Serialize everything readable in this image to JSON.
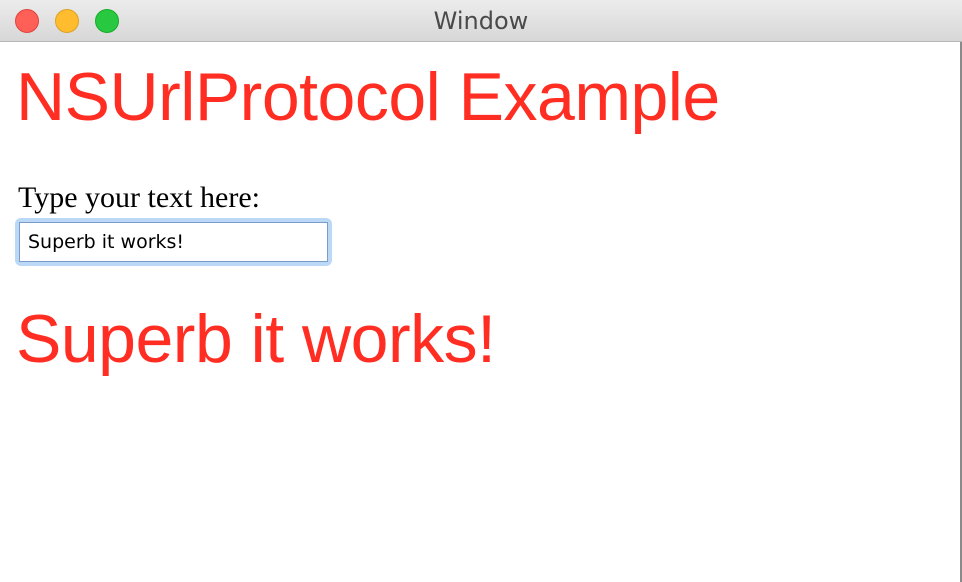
{
  "window": {
    "title": "Window"
  },
  "colors": {
    "accent": "#ff2d22",
    "focus_ring": "#bcd8f7"
  },
  "page": {
    "heading": "NSUrlProtocol Example",
    "prompt_label": "Type your text here:",
    "input": {
      "value": "Superb it works!",
      "placeholder": ""
    },
    "echo_output": "Superb it works!"
  }
}
